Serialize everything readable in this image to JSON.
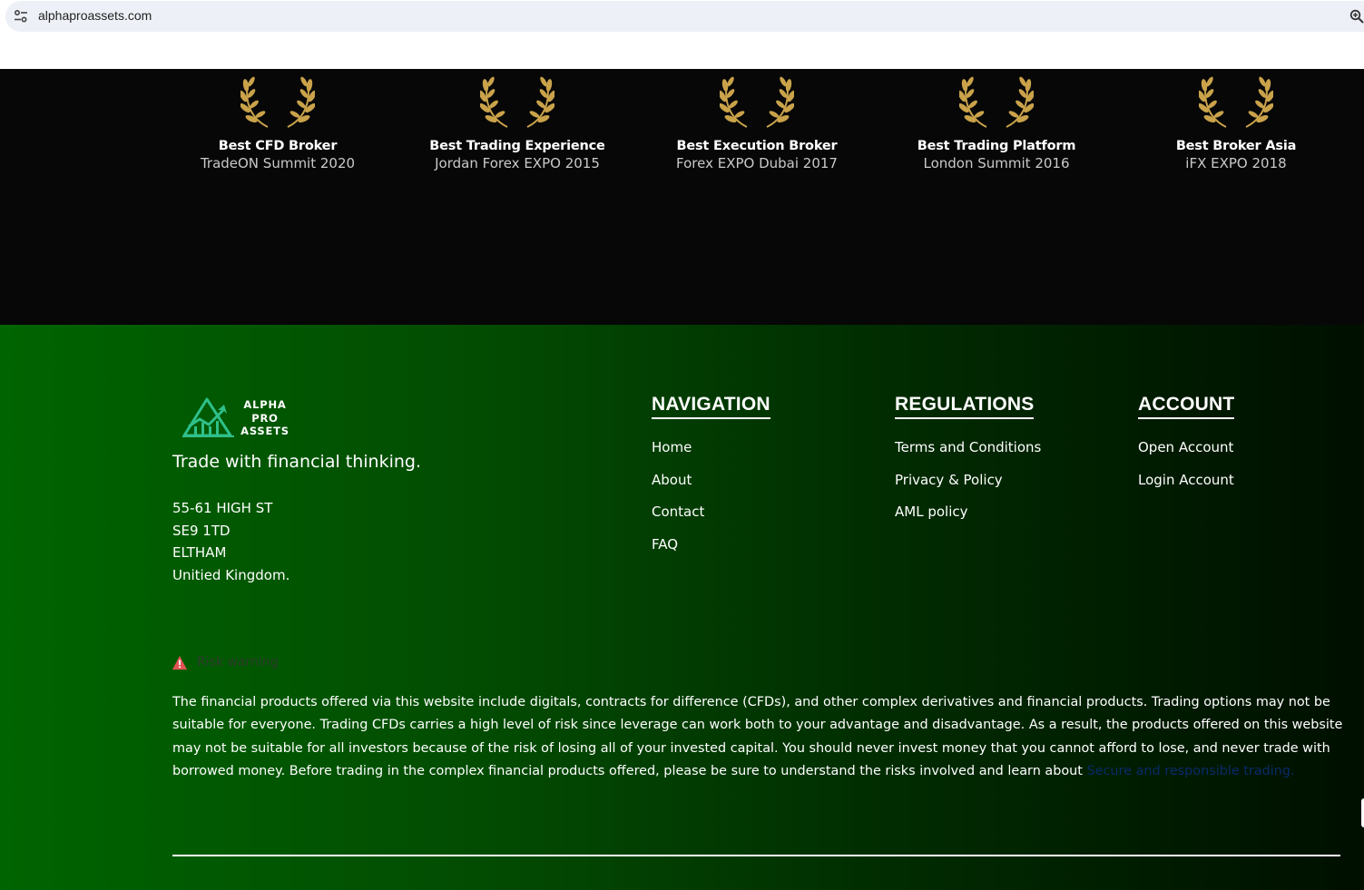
{
  "browser": {
    "url": "alphaproassets.com",
    "site_icon": "tune-icon",
    "zoom_icon": "zoom-icon"
  },
  "awards": [
    {
      "title": "Best CFD Broker",
      "subtitle": "TradeON Summit 2020"
    },
    {
      "title": "Best Trading Experience",
      "subtitle": "Jordan Forex EXPO 2015"
    },
    {
      "title": "Best Execution Broker",
      "subtitle": "Forex EXPO Dubai 2017"
    },
    {
      "title": "Best Trading Platform",
      "subtitle": "London Summit 2016"
    },
    {
      "title": "Best Broker Asia",
      "subtitle": "iFX EXPO 2018"
    }
  ],
  "footer": {
    "logo": {
      "line1": "ALPHA",
      "line2": "PRO",
      "line3": "ASSETS"
    },
    "tagline": "Trade with financial thinking.",
    "address": [
      "55-61 HIGH ST",
      "SE9 1TD",
      "ELTHAM",
      "Unitied Kingdom."
    ],
    "navigation": {
      "heading": "NAVIGATION",
      "links": [
        "Home",
        "About",
        "Contact",
        "FAQ"
      ]
    },
    "regulations": {
      "heading": "REGULATIONS",
      "links": [
        "Terms and Conditions",
        "Privacy & Policy",
        "AML policy"
      ]
    },
    "account": {
      "heading": "ACCOUNT",
      "links": [
        "Open Account",
        "Login Account"
      ]
    },
    "risk": {
      "label": "Risk warning",
      "text": "The financial products offered via this website include digitals, contracts for difference (CFDs), and other complex derivatives and financial products. Trading options may not be suitable for everyone. Trading CFDs carries a high level of risk since leverage can work both to your advantage and disadvantage. As a result, the products offered on this website may not be suitable for all investors because of the risk of losing all of your invested capital. You should never invest money that you cannot afford to lose, and never trade with borrowed money. Before trading in the complex financial products offered, please be sure to understand the risks involved and learn about ",
      "link": "Secure and responsible trading."
    }
  },
  "colors": {
    "laurel_gold": "#c9a24a",
    "footer_green": "#006400",
    "warning_red": "#e05555"
  }
}
